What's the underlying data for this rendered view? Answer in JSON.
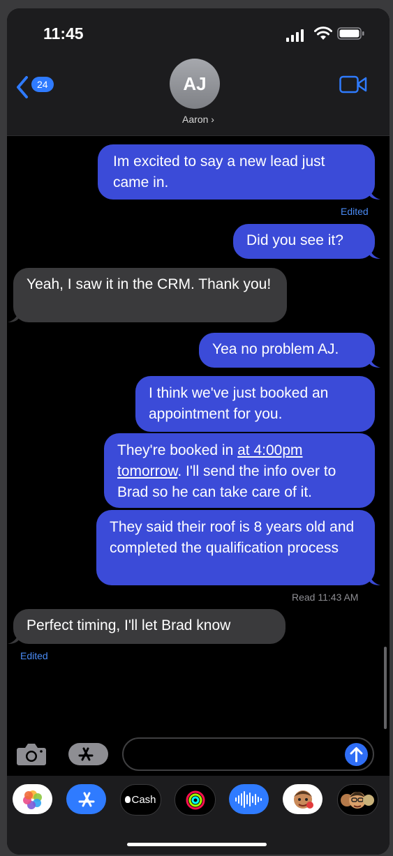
{
  "status_bar": {
    "time": "11:45"
  },
  "header": {
    "back_badge": "24",
    "avatar_initials": "AJ",
    "contact_name": "Aaron ›"
  },
  "messages": [
    {
      "from": "me",
      "text": "Im excited to say a new lead just came in."
    },
    {
      "from": "me",
      "text": "Did you see it?"
    },
    {
      "from": "them",
      "text": "Yeah, I saw it in the CRM. Thank you!"
    },
    {
      "from": "me",
      "text": "Yea no problem AJ."
    },
    {
      "from": "me",
      "text": "I think we've just booked an appointment for you."
    },
    {
      "from": "me",
      "text_parts": [
        "They're booked in ",
        "at 4:00pm tomorrow",
        ". I'll send the info over to Brad so he can take care of it."
      ]
    },
    {
      "from": "me",
      "text": "They said their roof is 8 years old and completed the qualification process"
    },
    {
      "from": "them",
      "text": "Perfect timing, I'll let Brad know"
    }
  ],
  "labels": {
    "edited_1": "Edited",
    "read_receipt": "Read 11:43 AM",
    "edited_2": "Edited"
  },
  "composer": {
    "placeholder": ""
  },
  "dock": {
    "cash_label": "Cash"
  }
}
